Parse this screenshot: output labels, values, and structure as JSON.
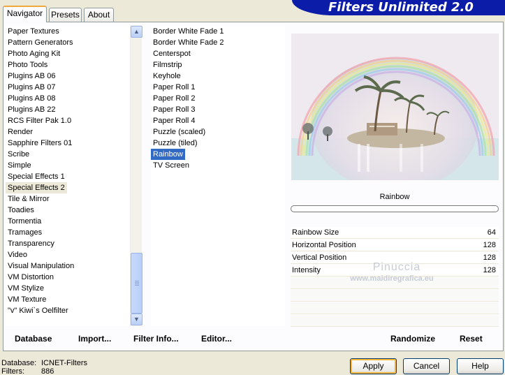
{
  "tabs": [
    "Navigator",
    "Presets",
    "About"
  ],
  "title": "Filters Unlimited 2.0",
  "categories": [
    "Paper Textures",
    "Pattern Generators",
    "Photo Aging Kit",
    "Photo Tools",
    "Plugins AB 06",
    "Plugins AB 07",
    "Plugins AB 08",
    "Plugins AB 22",
    "RCS Filter Pak 1.0",
    "Render",
    "Sapphire Filters 01",
    "Scribe",
    "Simple",
    "Special Effects 1",
    "Special Effects 2",
    "Tile & Mirror",
    "Toadies",
    "Tormentia",
    "Tramages",
    "Transparency",
    "Video",
    "Visual Manipulation",
    "VM Distortion",
    "VM Stylize",
    "VM Texture",
    "\"v\" Kiwi`s Oelfilter"
  ],
  "selected_category": "Special Effects 2",
  "filters": [
    "Border White Fade 1",
    "Border White Fade 2",
    "Centerspot",
    "Filmstrip",
    "Keyhole",
    "Paper Roll 1",
    "Paper Roll 2",
    "Paper Roll 3",
    "Paper Roll 4",
    "Puzzle (scaled)",
    "Puzzle (tiled)",
    "Rainbow",
    "TV Screen"
  ],
  "selected_filter": "Rainbow",
  "filter_name": "Rainbow",
  "parameters": [
    {
      "label": "Rainbow Size",
      "value": "64"
    },
    {
      "label": "Horizontal Position",
      "value": "128"
    },
    {
      "label": "Vertical Position",
      "value": "128"
    },
    {
      "label": "Intensity",
      "value": "128"
    }
  ],
  "watermark": {
    "line1": "Pinuccia",
    "line2": "www.maidiregrafica.eu"
  },
  "bottom_links": {
    "database": "Database",
    "import": "Import...",
    "filter_info": "Filter Info...",
    "editor": "Editor...",
    "randomize": "Randomize",
    "reset": "Reset"
  },
  "status": {
    "database_label": "Database:",
    "database_value": "ICNET-Filters",
    "filters_label": "Filters:",
    "filters_value": "886"
  },
  "buttons": {
    "apply": "Apply",
    "cancel": "Cancel",
    "help": "Help"
  },
  "colors": {
    "banner": "#0a1ca8",
    "selection": "#316ac5",
    "face": "#ece9d8"
  }
}
